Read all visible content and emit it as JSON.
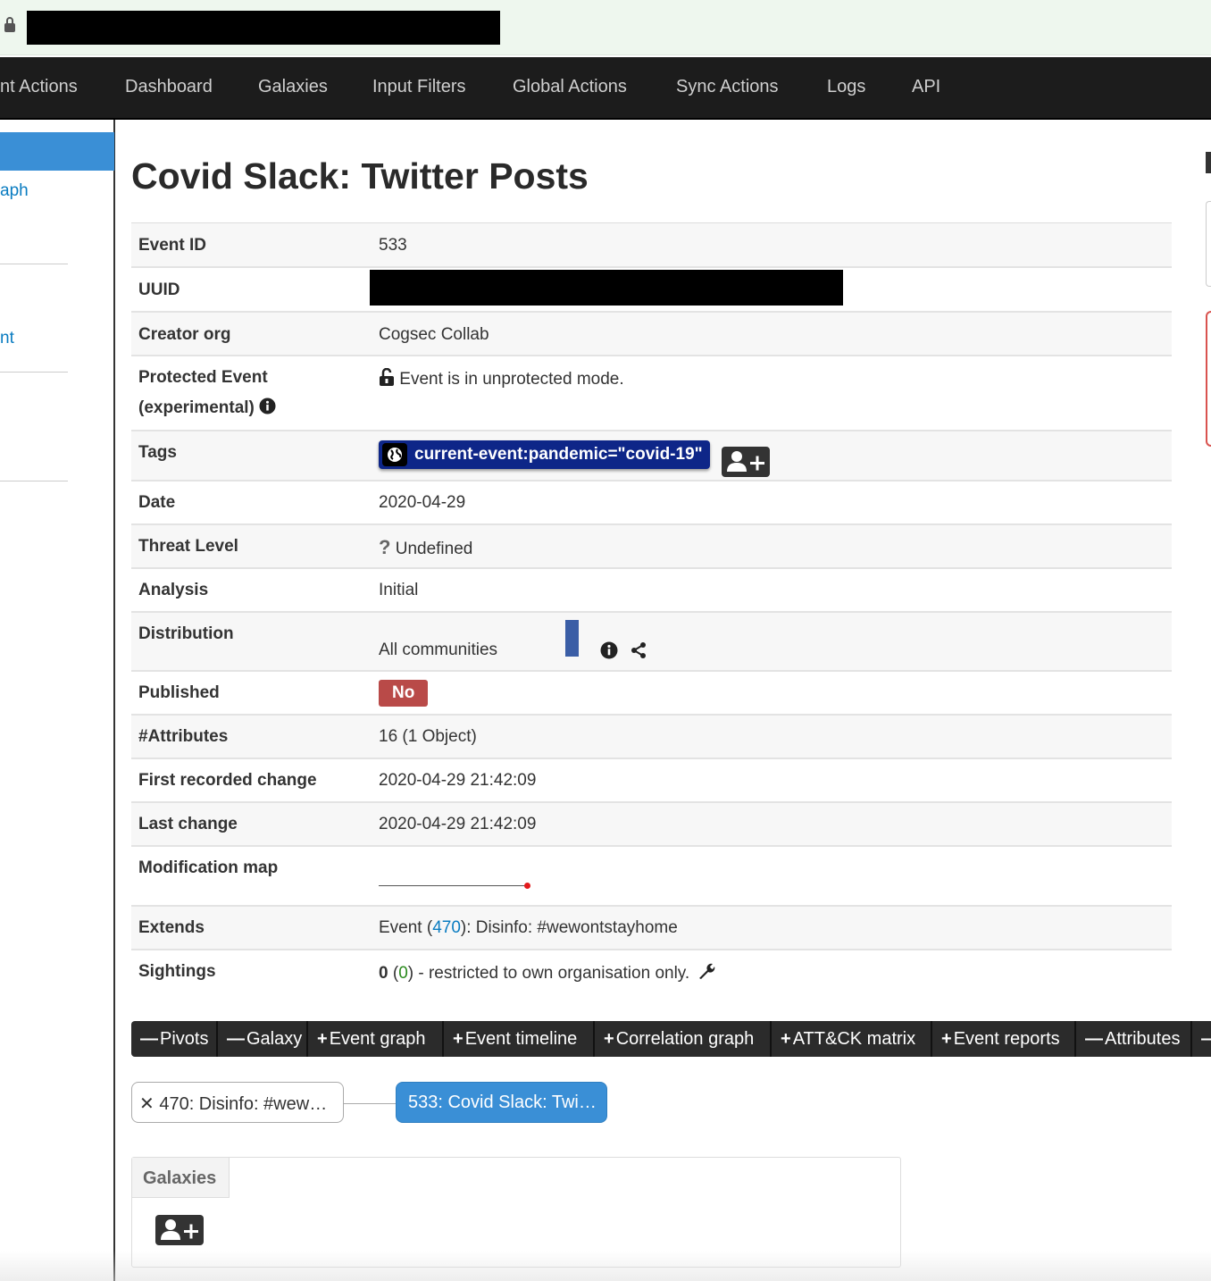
{
  "navbar": {
    "items": [
      "nt Actions",
      "Dashboard",
      "Galaxies",
      "Input Filters",
      "Global Actions",
      "Sync Actions",
      "Logs",
      "API"
    ]
  },
  "sidebar": {
    "links": [
      "aph",
      "nt"
    ]
  },
  "event": {
    "title": "Covid Slack: Twitter Posts",
    "fields": {
      "event_id": {
        "label": "Event ID",
        "value": "533"
      },
      "uuid": {
        "label": "UUID"
      },
      "creator_org": {
        "label": "Creator org",
        "value": "Cogsec Collab"
      },
      "protected": {
        "label_line1": "Protected Event",
        "label_line2": "(experimental)",
        "value": "Event is in unprotected mode."
      },
      "tags": {
        "label": "Tags",
        "tag": "current-event:pandemic=\"covid-19\""
      },
      "date": {
        "label": "Date",
        "value": "2020-04-29"
      },
      "threat_level": {
        "label": "Threat Level",
        "icon": "?",
        "value": "Undefined"
      },
      "analysis": {
        "label": "Analysis",
        "value": "Initial"
      },
      "distribution": {
        "label": "Distribution",
        "value": "All communities"
      },
      "published": {
        "label": "Published",
        "value": "No"
      },
      "attributes": {
        "label": "#Attributes",
        "value": "16 (1 Object)"
      },
      "first_change": {
        "label": "First recorded change",
        "value": "2020-04-29 21:42:09"
      },
      "last_change": {
        "label": "Last change",
        "value": "2020-04-29 21:42:09"
      },
      "modification_map": {
        "label": "Modification map"
      },
      "extends": {
        "label": "Extends",
        "prefix": "Event (",
        "event_link": "470",
        "suffix": "): Disinfo: #wewontstayhome"
      },
      "sightings": {
        "label": "Sightings",
        "count": "0",
        "open": " (",
        "own": "0",
        "close": ")",
        "text": " - restricted to own organisation only."
      }
    }
  },
  "toolbar": {
    "buttons": [
      {
        "sign": "—",
        "label": "Pivots"
      },
      {
        "sign": "—",
        "label": "Galaxy"
      },
      {
        "sign": "+",
        "label": "Event graph"
      },
      {
        "sign": "+",
        "label": "Event timeline"
      },
      {
        "sign": "+",
        "label": "Correlation graph"
      },
      {
        "sign": "+",
        "label": "ATT&CK matrix"
      },
      {
        "sign": "+",
        "label": "Event reports"
      },
      {
        "sign": "—",
        "label": "Attributes"
      },
      {
        "sign": "—",
        "label": ""
      }
    ]
  },
  "relations": {
    "left_close": "✕",
    "left_label": "470: Disinfo: #wew…",
    "right_label": "533: Covid Slack: Twi…"
  },
  "galaxies": {
    "tab_label": "Galaxies"
  },
  "colors": {
    "navbar_bg": "#1c1c1c",
    "link": "#0a7cc1",
    "tag_bg": "#0e2688",
    "published_no": "#b94a48",
    "distribution_bar": "#3b5ea6",
    "active_blue": "#3a8fd6"
  }
}
